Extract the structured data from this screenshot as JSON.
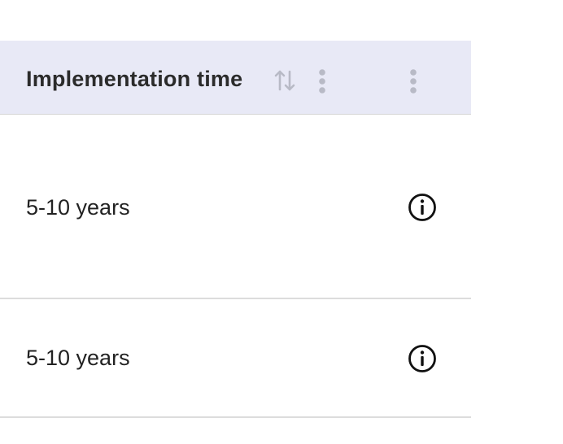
{
  "table": {
    "header": {
      "column_label": "Implementation time",
      "sort_icon": "sort-arrows-icon",
      "menu_icon": "kebab-menu-icon"
    },
    "rows": [
      {
        "implementation_time": "5-10 years",
        "info_icon": "info-icon"
      },
      {
        "implementation_time": "5-10 years",
        "info_icon": "info-icon"
      }
    ]
  },
  "colors": {
    "header_background": "#e8e9f6",
    "divider": "#dcdcdc",
    "icon_muted": "#b8bac6",
    "text": "#222222"
  }
}
